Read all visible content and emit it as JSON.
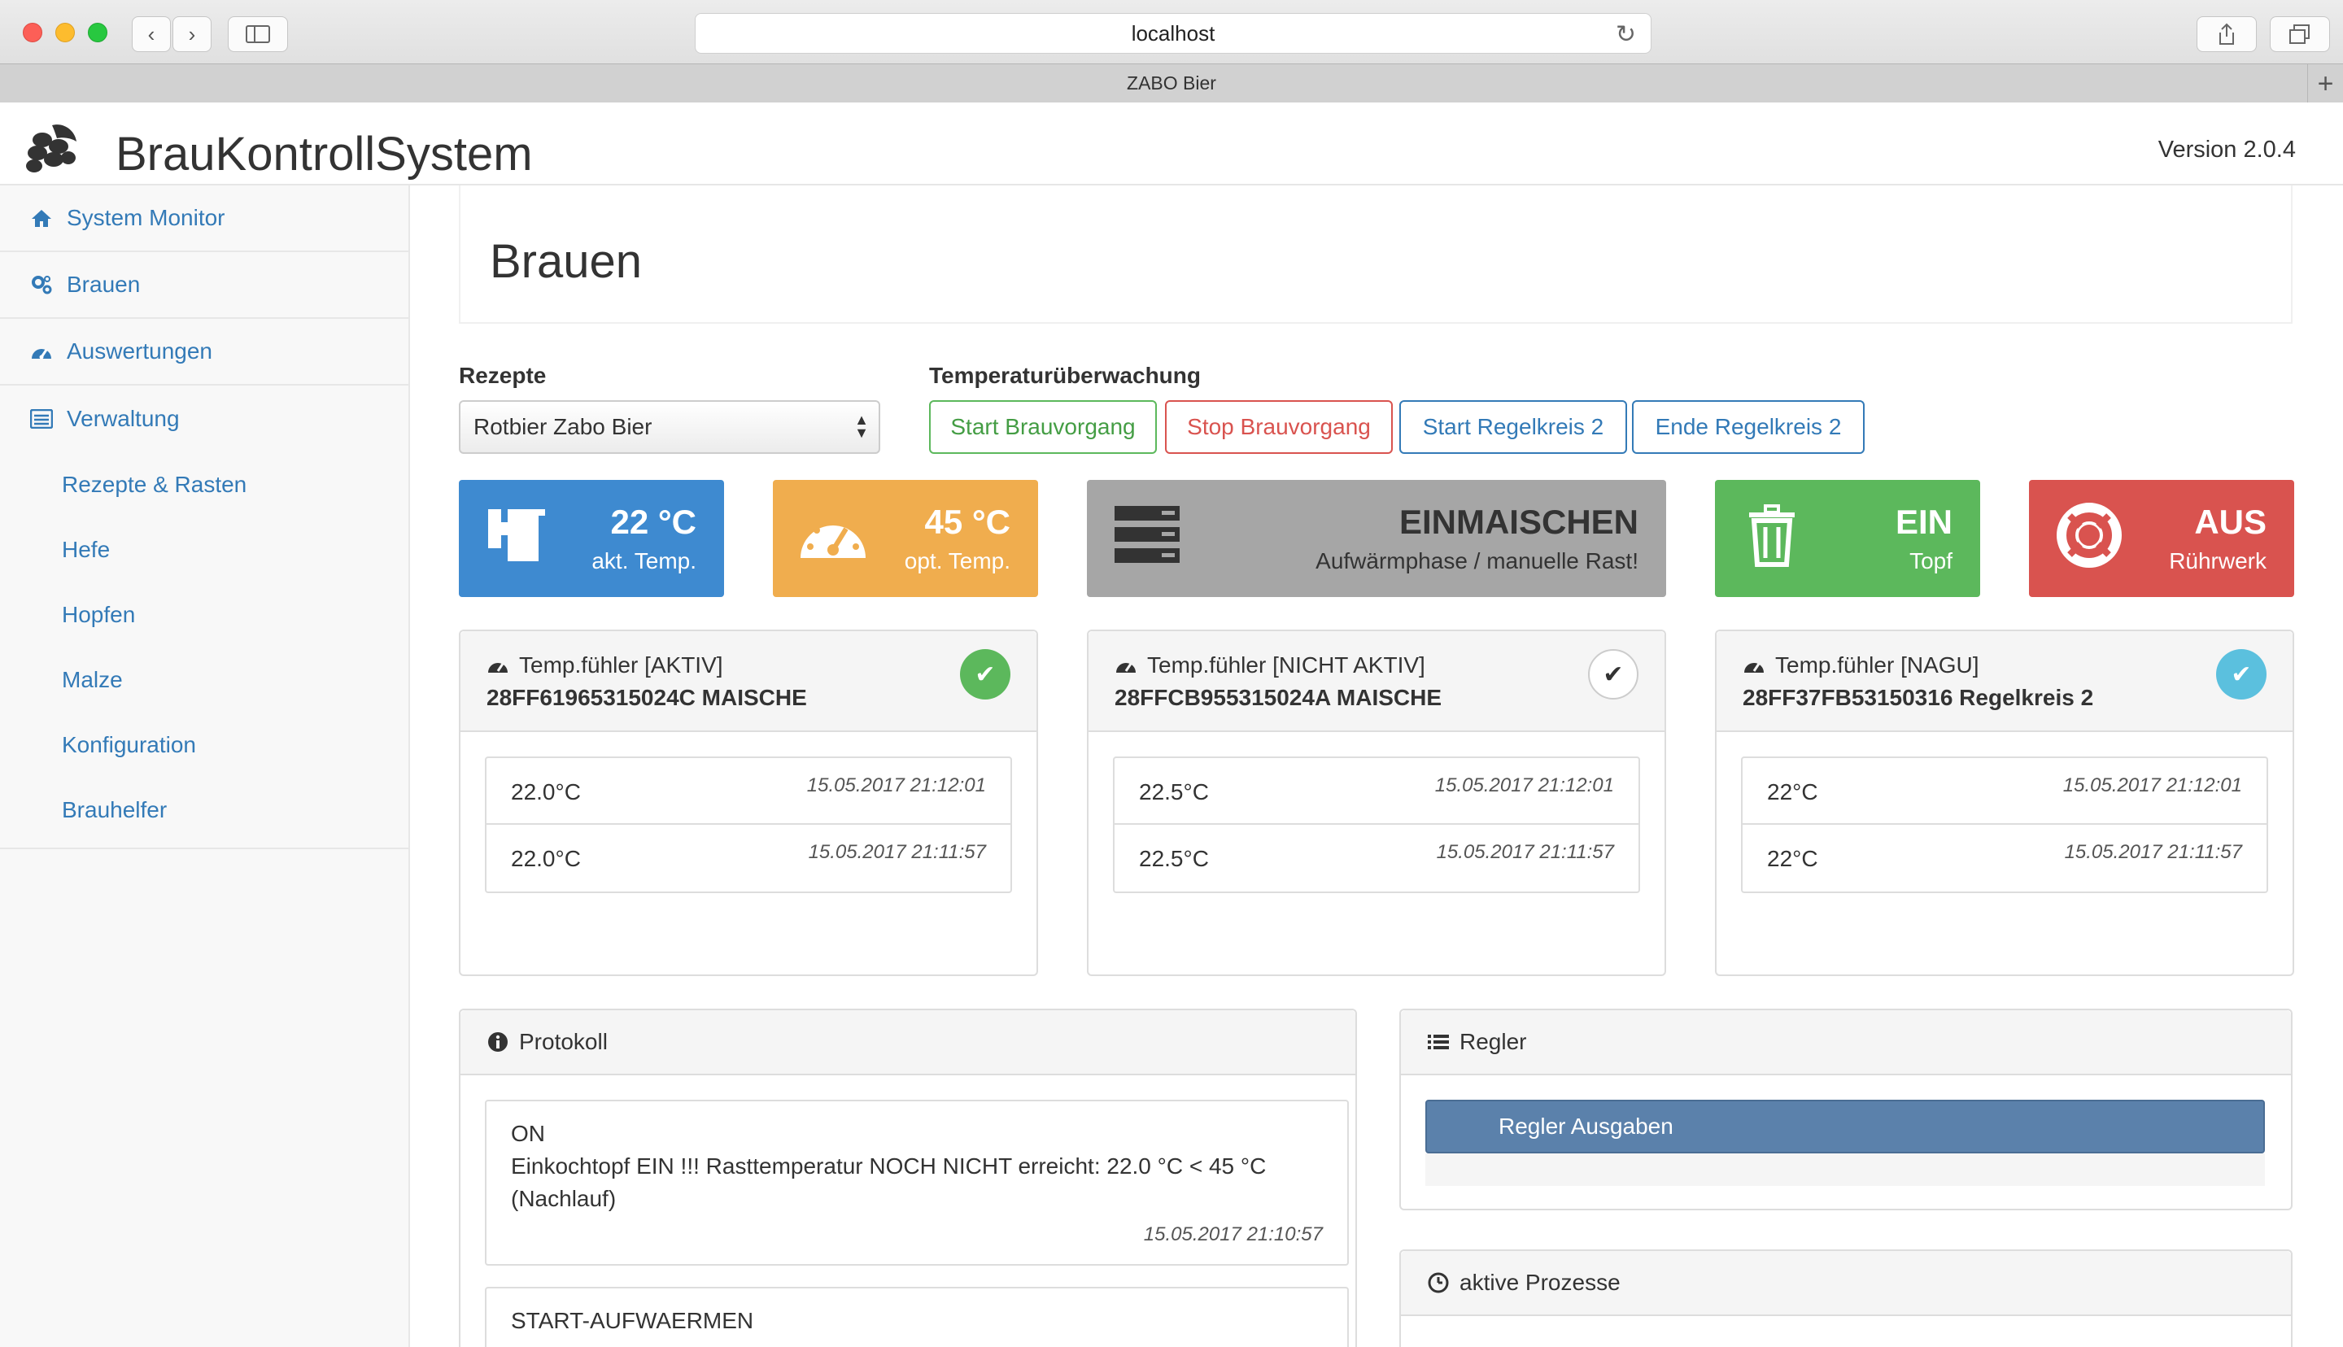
{
  "browser": {
    "url": "localhost",
    "tab_title": "ZABO Bier"
  },
  "app": {
    "title": "BrauKontrollSystem",
    "version": "Version 2.0.4"
  },
  "sidebar": {
    "items": [
      {
        "label": "System Monitor",
        "icon": "home-icon"
      },
      {
        "label": "Brauen",
        "icon": "cogs-icon"
      },
      {
        "label": "Auswertungen",
        "icon": "dashboard-icon"
      },
      {
        "label": "Verwaltung",
        "icon": "list-icon"
      }
    ],
    "subitems": [
      "Rezepte & Rasten",
      "Hefe",
      "Hopfen",
      "Malze",
      "Konfiguration",
      "Brauhelfer"
    ]
  },
  "page": {
    "title": "Brauen"
  },
  "recipes": {
    "label": "Rezepte",
    "selected": "Rotbier Zabo Bier"
  },
  "monitor": {
    "label": "Temperaturüberwachung",
    "buttons": [
      "Start Brauvorgang",
      "Stop Brauvorgang",
      "Start Regelkreis 2",
      "Ende Regelkreis 2"
    ]
  },
  "tiles": [
    {
      "big": "22 °C",
      "small": "akt. Temp.",
      "icon": "kettle-icon",
      "color": "#3e8ad0"
    },
    {
      "big": "45 °C",
      "small": "opt. Temp.",
      "icon": "gauge-icon",
      "color": "#f0ad4e"
    },
    {
      "big": "EINMAISCHEN",
      "small": "Aufwärmphase / manuelle Rast!",
      "icon": "server-icon",
      "color": "#a6a6a6"
    },
    {
      "big": "EIN",
      "small": "Topf",
      "icon": "trash-icon",
      "color": "#5cb85c"
    },
    {
      "big": "AUS",
      "small": "Rührwerk",
      "icon": "lifebuoy-icon",
      "color": "#d9534f"
    }
  ],
  "sensors": [
    {
      "status": "Temp.fühler [AKTIV]",
      "id": "28FF61965315024C MAISCHE",
      "readings": [
        {
          "value": "22.0°C",
          "time": "15.05.2017 21:12:01"
        },
        {
          "value": "22.0°C",
          "time": "15.05.2017 21:11:57"
        }
      ]
    },
    {
      "status": "Temp.fühler [NICHT AKTIV]",
      "id": "28FFCB955315024A MAISCHE",
      "readings": [
        {
          "value": "22.5°C",
          "time": "15.05.2017 21:12:01"
        },
        {
          "value": "22.5°C",
          "time": "15.05.2017 21:11:57"
        }
      ]
    },
    {
      "status": "Temp.fühler [NAGU]",
      "id": "28FF37FB53150316 Regelkreis 2",
      "readings": [
        {
          "value": "22°C",
          "time": "15.05.2017 21:12:01"
        },
        {
          "value": "22°C",
          "time": "15.05.2017 21:11:57"
        }
      ]
    }
  ],
  "protokoll": {
    "title": "Protokoll",
    "entries": [
      {
        "line1": "ON",
        "line2": "Einkochtopf EIN !!! Rasttemperatur NOCH NICHT erreicht: 22.0 °C < 45 °C",
        "line3": "(Nachlauf)",
        "time": "15.05.2017 21:10:57"
      },
      {
        "line1": "START-AUFWAERMEN"
      }
    ]
  },
  "regler": {
    "title": "Regler",
    "button": "Regler Ausgaben"
  },
  "prozesse": {
    "title": "aktive Prozesse"
  }
}
